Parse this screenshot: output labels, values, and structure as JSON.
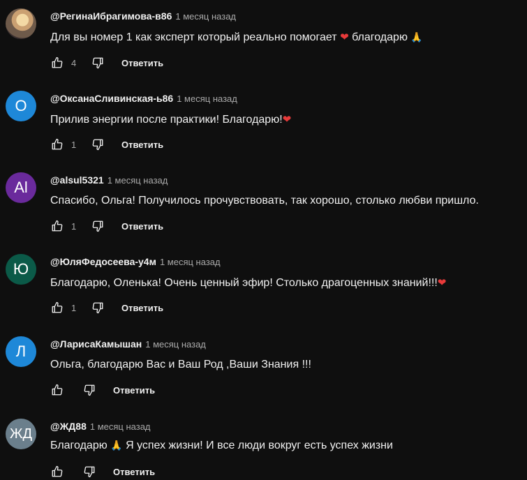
{
  "reply_label": "Ответить",
  "comments": [
    {
      "author": "@РегинаИбрагимова-в86",
      "time": "1 месяц назад",
      "text": "Для вы номер 1 как эксперт который реально помогает",
      "text_after": "благодарю",
      "likes": "4",
      "avatar": {
        "type": "photo"
      }
    },
    {
      "author": "@ОксанаСливинская-ь86",
      "time": "1 месяц назад",
      "text": "Прилив энергии после практики! Благодарю!",
      "likes": "1",
      "avatar": {
        "letter": "О",
        "color": "#1e88d8"
      }
    },
    {
      "author": "@alsul5321",
      "time": "1 месяц назад",
      "text": "Спасибо, Ольга! Получилось прочувствовать, так хорошо, столько любви пришло.",
      "likes": "1",
      "avatar": {
        "letter": "Al",
        "color": "#6a2a9c"
      }
    },
    {
      "author": "@ЮляФедосеева-у4м",
      "time": "1 месяц назад",
      "text": "Благодарю, Оленька! Очень ценный эфир! Столько драгоценных знаний!!!",
      "likes": "1",
      "avatar": {
        "letter": "Ю",
        "color": "#0b5a48"
      }
    },
    {
      "author": "@ЛарисаКамышан",
      "time": "1 месяц назад",
      "text": "Ольга, благодарю Вас и Ваш Род ,Ваши Знания !!!",
      "likes": "",
      "avatar": {
        "letter": "Л",
        "color": "#1e88d8"
      }
    },
    {
      "author": "@ЖД88",
      "time": "1 месяц назад",
      "text": "Благодарю",
      "text_after": "Я успех жизни! И все люди вокруг есть успех жизни",
      "likes": "",
      "avatar": {
        "letter": "ЖД",
        "color": "#6b7f8c"
      }
    }
  ]
}
